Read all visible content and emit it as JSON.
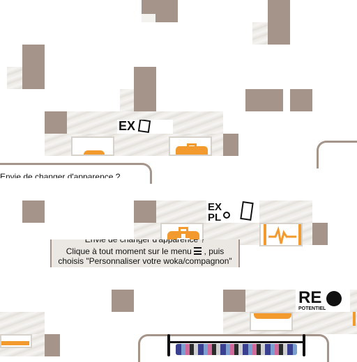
{
  "tooltip_top": {
    "line1": "Envie de changer d'apparence ?"
  },
  "tooltip_main": {
    "line1": "Envie de changer d'apparence ?",
    "line2_prefix": "Clique à tout moment sur le menu",
    "line2_suffix": ", puis",
    "line3": "choisis \"Personnaliser votre woka/compagnon\""
  },
  "icons": {
    "medical": "medical-kit-icon",
    "heartbeat": "heartbeat-icon",
    "menu": "hamburger-menu-icon",
    "explore_logo_text": "EX PL",
    "revele_logo_text": "RE",
    "revele_sub": "POTENTIEL"
  },
  "colors": {
    "accent": "#f39a2e",
    "wall": "#ebe8e3",
    "pillar": "#a4948a"
  }
}
